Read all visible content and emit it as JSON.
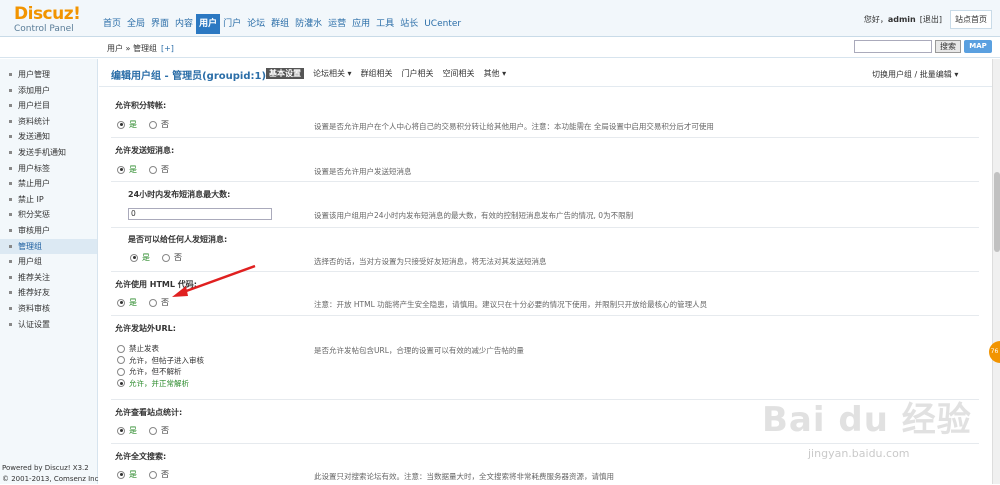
{
  "logo": {
    "main": "Discuz!",
    "sub": "Control Panel"
  },
  "topnav": [
    "首页",
    "全局",
    "界面",
    "内容",
    "用户",
    "门户",
    "论坛",
    "群组",
    "防灌水",
    "运营",
    "应用",
    "工具",
    "站长",
    "UCenter"
  ],
  "topnav_active": "用户",
  "topright": {
    "greeting": "您好，",
    "username": "admin",
    "logout": "[退出]",
    "sitehome": "站点首页"
  },
  "breadcrumb": {
    "path": "用户 » 管理组",
    "add": "[+]"
  },
  "search": {
    "button": "搜索",
    "map": "MAP"
  },
  "sidebar": {
    "items": [
      "用户管理",
      "添加用户",
      "用户栏目",
      "资料统计",
      "发送通知",
      "发送手机通知",
      "用户标签",
      "禁止用户",
      "禁止 IP",
      "积分奖惩",
      "审核用户",
      "管理组",
      "用户组",
      "推荐关注",
      "推荐好友",
      "资料审核",
      "认证设置"
    ],
    "active": "管理组"
  },
  "footer": {
    "line1": "Powered by Discuz! X3.2",
    "line2": "© 2001-2013, Comsenz Inc."
  },
  "page": {
    "title": "编辑用户组 - 管理员(groupid:1)",
    "tabs": [
      {
        "label": "基本设置",
        "active": true
      },
      {
        "label": "论坛相关 ▾",
        "active": false
      },
      {
        "label": "群组相关",
        "active": false
      },
      {
        "label": "门户相关",
        "active": false
      },
      {
        "label": "空间相关",
        "active": false
      },
      {
        "label": "其他 ▾",
        "active": false
      }
    ],
    "right_link": "切换用户组 / 批量编辑 ▾"
  },
  "yes_label": "是",
  "no_label": "否",
  "settings": {
    "transfer": {
      "title": "允许积分转帐:",
      "desc": "设置是否允许用户在个人中心将自己的交易积分转让给其他用户。注意：本功能需在 全局设置中启用交易积分后才可使用"
    },
    "pm": {
      "title": "允许发送短消息:",
      "desc": "设置是否允许用户发送短消息"
    },
    "pm_max": {
      "title": "24小时内发布短消息最大数:",
      "value": "0",
      "desc": "设置该用户组用户24小时内发布短消息的最大数，有效的控制短消息发布广告的情况, 0为不限制"
    },
    "pm_any": {
      "title": "是否可以给任何人发短消息:",
      "desc": "选择否的话，当对方设置为只接受好友短消息，将无法对其发送短消息"
    },
    "html": {
      "title": "允许使用 HTML 代码:",
      "desc": "注意：开放 HTML 功能将产生安全隐患，请慎用。建议只在十分必要的情况下使用，并限制只开放给最核心的管理人员"
    },
    "url": {
      "title": "允许发站外URL:",
      "options": [
        "禁止发表",
        "允许，但帖子进入审核",
        "允许，但不解析",
        "允许，并正常解析"
      ],
      "desc": "是否允许发帖包含URL，合理的设置可以有效的减少广告帖的量"
    },
    "stats": {
      "title": "允许查看站点统计:"
    },
    "fulltext": {
      "title": "允许全文搜索:",
      "desc": "此设置只对搜索论坛有效。注意：当数据量大时，全文搜索将非常耗费服务器资源，请慎用"
    }
  },
  "side_badge": "76",
  "watermark": {
    "text": "Bai du 经验",
    "url": "jingyan.baidu.com"
  }
}
